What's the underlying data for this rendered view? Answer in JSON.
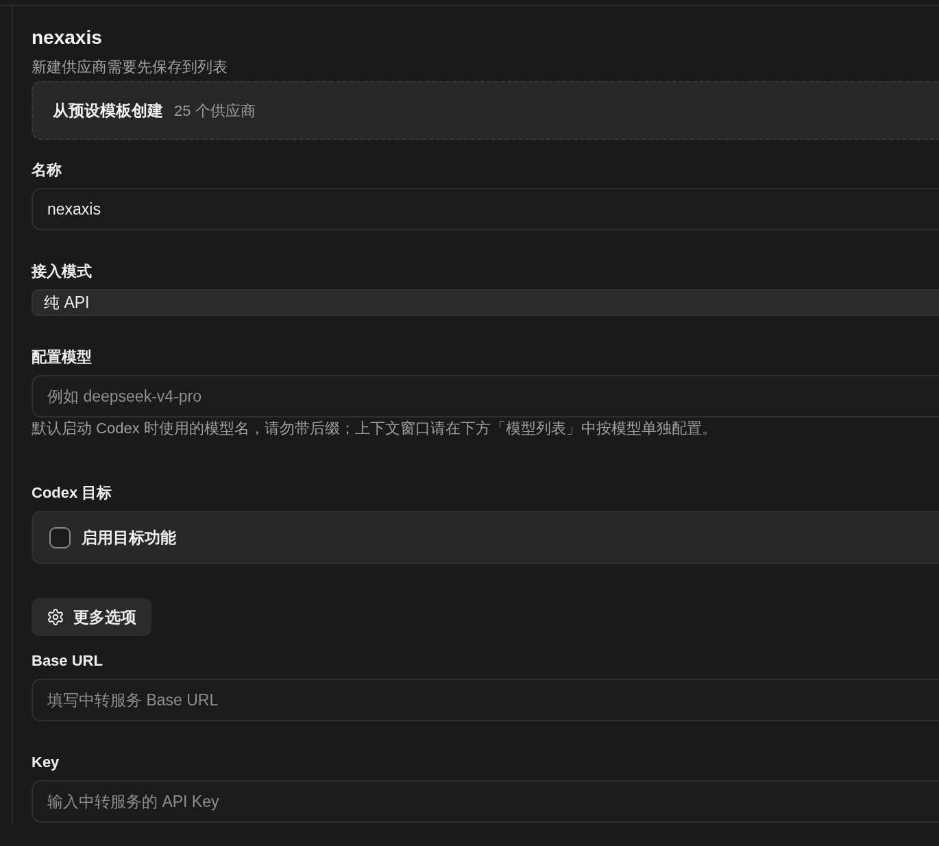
{
  "header": {
    "title": "nexaxis",
    "subtitle": "新建供应商需要先保存到列表"
  },
  "template_button": {
    "label": "从预设模板创建",
    "count": "25 个供应商"
  },
  "fields": [
    {
      "kind": "text",
      "label": "名称",
      "value": "nexaxis"
    },
    {
      "kind": "select",
      "label": "接入模式",
      "value": "纯 API"
    },
    {
      "kind": "text",
      "label": "配置模型",
      "placeholder": "例如 deepseek-v4-pro",
      "help": "默认启动 Codex 时使用的模型名，请勿带后缀；上下文窗口请在下方「模型列表」中按模型单独配置。"
    },
    {
      "kind": "checkbox",
      "label": "Codex 目标",
      "option": "启用目标功能",
      "checked": false
    },
    {
      "kind": "button",
      "label": "更多选项"
    },
    {
      "kind": "text",
      "label": "Base URL",
      "placeholder": "填写中转服务 Base URL"
    },
    {
      "kind": "text",
      "label": "Key",
      "placeholder": "输入中转服务的 API Key"
    }
  ]
}
